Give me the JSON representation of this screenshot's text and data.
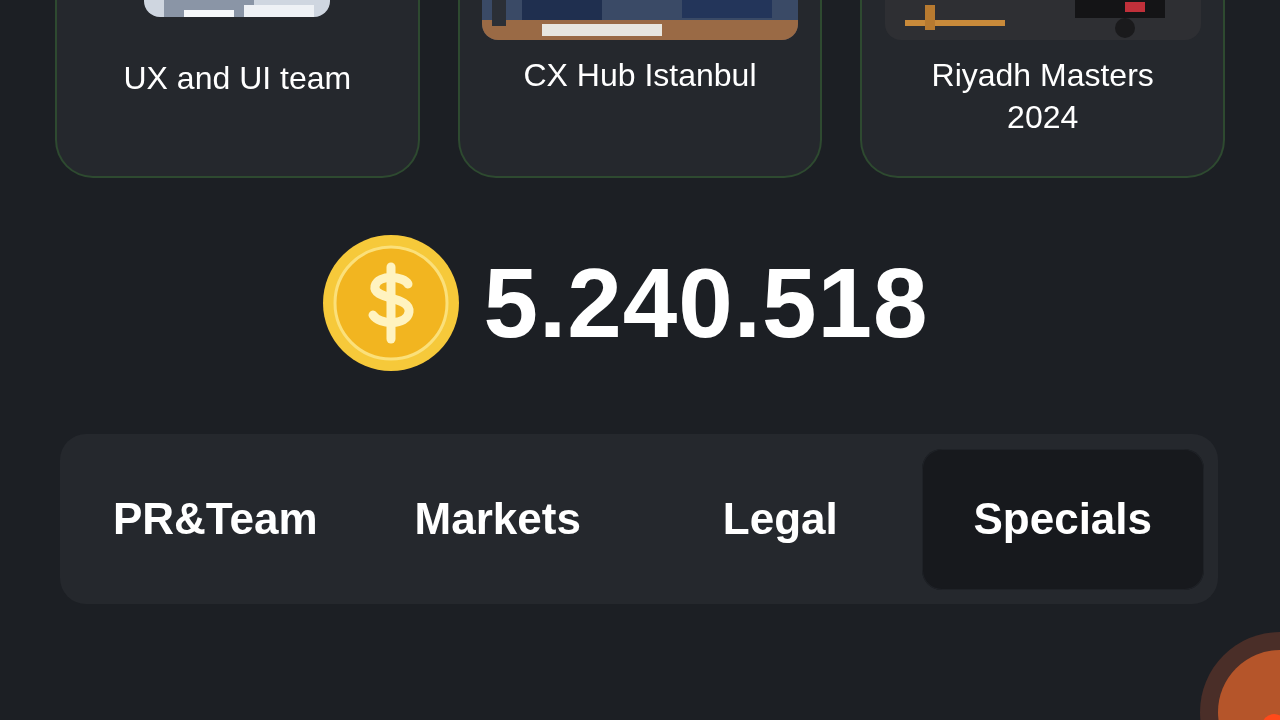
{
  "cards": [
    {
      "title": "UX and UI team"
    },
    {
      "title": "CX Hub Istanbul"
    },
    {
      "title": "Riyadh Masters 2024"
    }
  ],
  "balance": {
    "amount": "5.240.518"
  },
  "tabs": [
    {
      "label": "PR&Team",
      "selected": false
    },
    {
      "label": "Markets",
      "selected": false
    },
    {
      "label": "Legal",
      "selected": false
    },
    {
      "label": "Specials",
      "selected": true
    }
  ]
}
